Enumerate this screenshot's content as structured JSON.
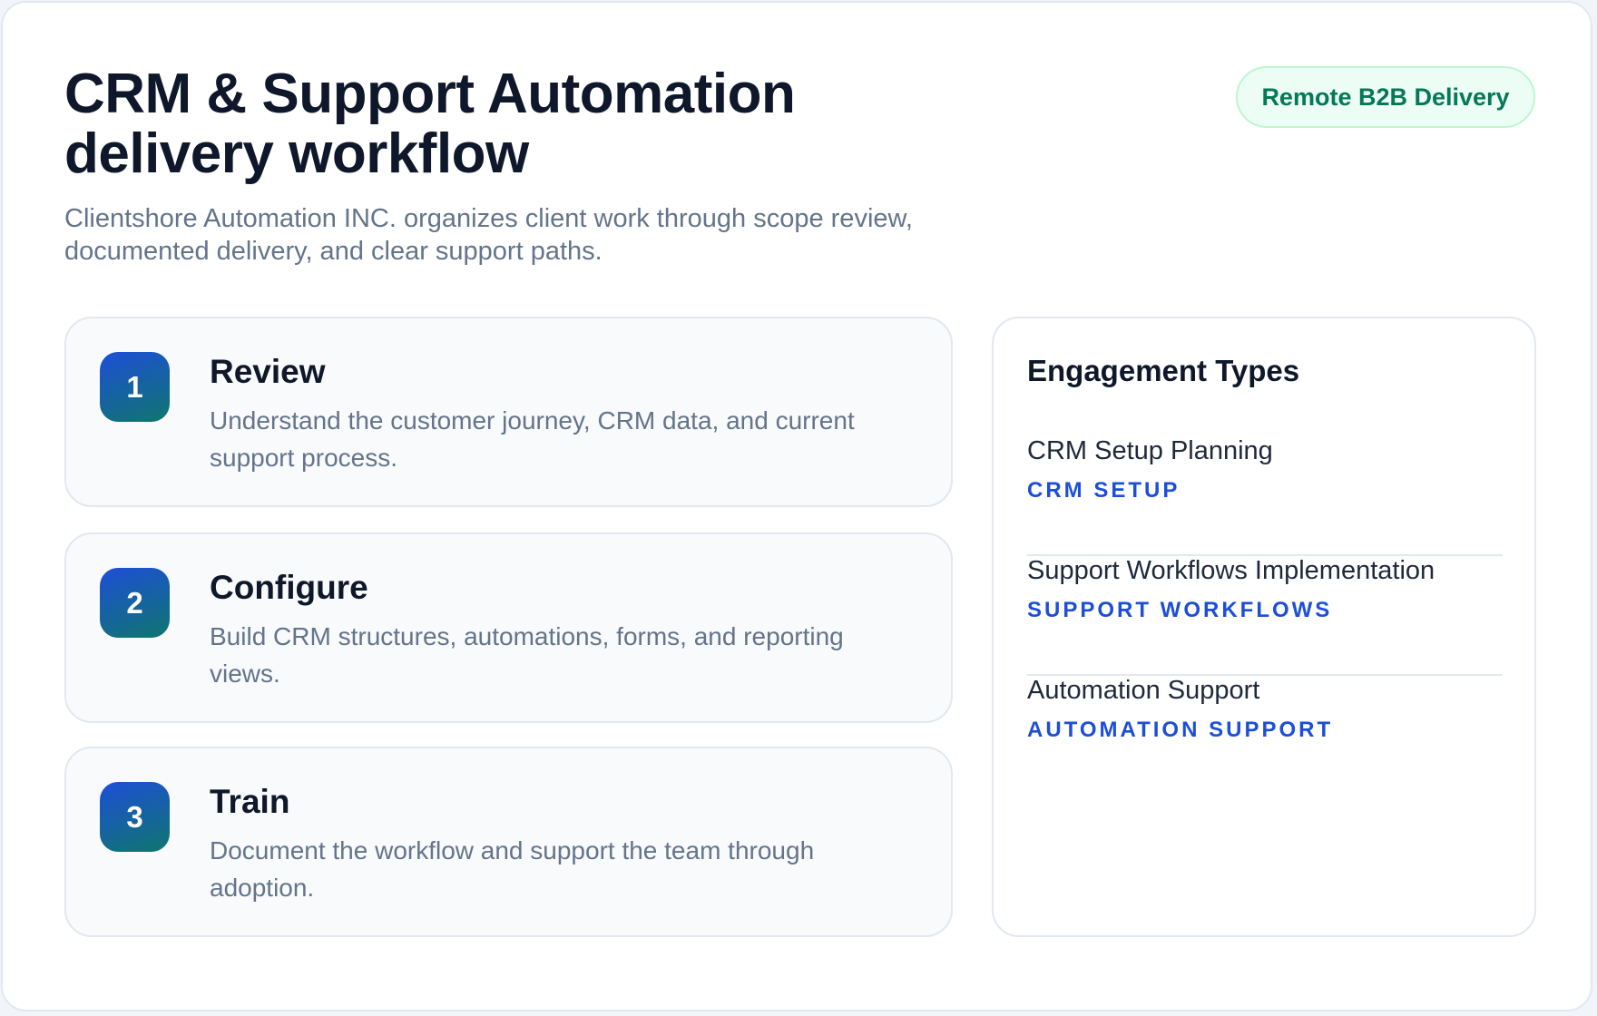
{
  "header": {
    "title": "CRM & Support Automation delivery workflow",
    "subtitle": "Clientshore Automation INC. organizes client work through scope review, documented delivery, and clear support paths.",
    "badge": "Remote B2B Delivery"
  },
  "steps": [
    {
      "number": "1",
      "title": "Review",
      "description": "Understand the customer journey, CRM data, and current support process."
    },
    {
      "number": "2",
      "title": "Configure",
      "description": "Build CRM structures, automations, forms, and reporting views."
    },
    {
      "number": "3",
      "title": "Train",
      "description": "Document the workflow and support the team through adoption."
    }
  ],
  "engagement": {
    "title": "Engagement Types",
    "items": [
      {
        "name": "CRM Setup Planning",
        "tag": "CRM SETUP"
      },
      {
        "name": "Support Workflows Implementation",
        "tag": "SUPPORT WORKFLOWS"
      },
      {
        "name": "Automation Support",
        "tag": "AUTOMATION SUPPORT"
      }
    ]
  },
  "colors": {
    "accent": "#1d4ed8",
    "badge_text": "#047857",
    "badge_bg": "#ecfdf5",
    "heading": "#0f172a",
    "muted_text": "#64748b"
  }
}
